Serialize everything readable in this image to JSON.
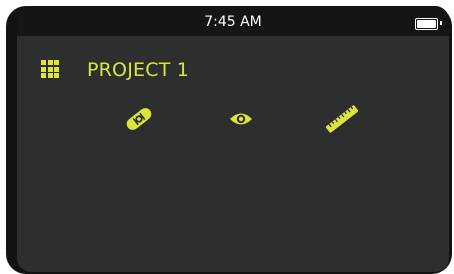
{
  "status_bar": {
    "time": "7:45 AM",
    "battery_icon": "battery-full-icon"
  },
  "header": {
    "menu_icon": "grid-menu-icon",
    "title": "PROJECT 1"
  },
  "tools": [
    {
      "icon": "level-tool-icon"
    },
    {
      "icon": "eye-view-icon"
    },
    {
      "icon": "ruler-measure-icon"
    }
  ],
  "colors": {
    "accent": "#dbe53a",
    "screen_background": "#2c2f2e",
    "status_bar_background": "#151515",
    "bezel": "#121212"
  }
}
